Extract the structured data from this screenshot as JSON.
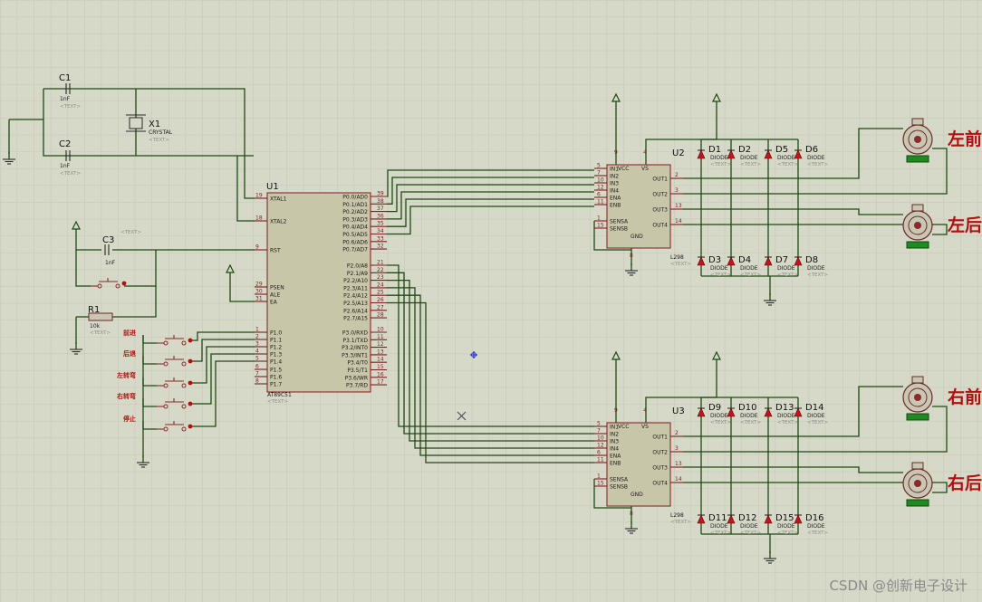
{
  "watermark": "CSDN @创新电子设计",
  "components": {
    "c1": {
      "ref": "C1",
      "value": "1nF",
      "text": "<TEXT>"
    },
    "c2": {
      "ref": "C2",
      "value": "1nF",
      "text": "<TEXT>"
    },
    "c3": {
      "ref": "C3",
      "value": "1nF",
      "text": "<TEXT>"
    },
    "x1": {
      "ref": "X1",
      "value": "CRYSTAL",
      "text": "<TEXT>"
    },
    "r1": {
      "ref": "R1",
      "value": "10k",
      "text": "<TEXT>"
    },
    "u1": {
      "ref": "U1",
      "part": "AT89C51",
      "text": "<TEXT>"
    },
    "u2": {
      "ref": "U2",
      "part": "L298",
      "text": "<TEXT>"
    },
    "u3": {
      "ref": "U3",
      "part": "L298",
      "text": "<TEXT>"
    }
  },
  "u1_pins_left": [
    {
      "num": "19",
      "name": "XTAL1"
    },
    {
      "num": "18",
      "name": "XTAL2"
    },
    {
      "num": "9",
      "name": "RST"
    },
    {
      "num": "29",
      "name": "PSEN"
    },
    {
      "num": "30",
      "name": "ALE"
    },
    {
      "num": "31",
      "name": "EA"
    },
    {
      "num": "1",
      "name": "P1.0"
    },
    {
      "num": "2",
      "name": "P1.1"
    },
    {
      "num": "3",
      "name": "P1.2"
    },
    {
      "num": "4",
      "name": "P1.3"
    },
    {
      "num": "5",
      "name": "P1.4"
    },
    {
      "num": "6",
      "name": "P1.5"
    },
    {
      "num": "7",
      "name": "P1.6"
    },
    {
      "num": "8",
      "name": "P1.7"
    }
  ],
  "u1_pins_right": [
    {
      "num": "39",
      "name": "P0.0/AD0"
    },
    {
      "num": "38",
      "name": "P0.1/AD1"
    },
    {
      "num": "37",
      "name": "P0.2/AD2"
    },
    {
      "num": "36",
      "name": "P0.3/AD3"
    },
    {
      "num": "35",
      "name": "P0.4/AD4"
    },
    {
      "num": "34",
      "name": "P0.5/AD5"
    },
    {
      "num": "33",
      "name": "P0.6/AD6"
    },
    {
      "num": "32",
      "name": "P0.7/AD7"
    },
    {
      "num": "21",
      "name": "P2.0/A8"
    },
    {
      "num": "22",
      "name": "P2.1/A9"
    },
    {
      "num": "23",
      "name": "P2.2/A10"
    },
    {
      "num": "24",
      "name": "P2.3/A11"
    },
    {
      "num": "25",
      "name": "P2.4/A12"
    },
    {
      "num": "26",
      "name": "P2.5/A13"
    },
    {
      "num": "27",
      "name": "P2.6/A14"
    },
    {
      "num": "28",
      "name": "P2.7/A15"
    },
    {
      "num": "10",
      "name": "P3.0/RXD"
    },
    {
      "num": "11",
      "name": "P3.1/TXD"
    },
    {
      "num": "12",
      "name": "P3.2/INT0"
    },
    {
      "num": "13",
      "name": "P3.3/INT1"
    },
    {
      "num": "14",
      "name": "P3.4/T0"
    },
    {
      "num": "15",
      "name": "P3.5/T1"
    },
    {
      "num": "16",
      "name": "P3.6/WR"
    },
    {
      "num": "17",
      "name": "P3.7/RD"
    }
  ],
  "l298_pins_left": [
    {
      "num": "5",
      "name": "IN1"
    },
    {
      "num": "7",
      "name": "IN2"
    },
    {
      "num": "10",
      "name": "IN3"
    },
    {
      "num": "12",
      "name": "IN4"
    },
    {
      "num": "6",
      "name": "ENA"
    },
    {
      "num": "11",
      "name": "ENB"
    },
    {
      "num": "1",
      "name": "SENSA"
    },
    {
      "num": "15",
      "name": "SENSB"
    }
  ],
  "l298_pins_right": [
    {
      "num": "2",
      "name": "OUT1"
    },
    {
      "num": "3",
      "name": "OUT2"
    },
    {
      "num": "13",
      "name": "OUT3"
    },
    {
      "num": "14",
      "name": "OUT4"
    }
  ],
  "l298_top": {
    "vcc_num": "9",
    "vcc": "VCC",
    "vs_num": "4",
    "vs": "VS"
  },
  "l298_bottom": {
    "gnd_num": "8",
    "gnd": "GND"
  },
  "diodes_u2_top": [
    "D1",
    "D2",
    "D5",
    "D6"
  ],
  "diodes_u2_bottom": [
    "D3",
    "D4",
    "D7",
    "D8"
  ],
  "diodes_u3_top": [
    "D9",
    "D10",
    "D13",
    "D14"
  ],
  "diodes_u3_bottom": [
    "D11",
    "D12",
    "D15",
    "D16"
  ],
  "diode_type": "DIODE",
  "placeholder": "<TEXT>",
  "buttons": [
    "前进",
    "后退",
    "左转弯",
    "右转弯",
    "停止"
  ],
  "motors": [
    "左前",
    "左后",
    "右前",
    "右后"
  ]
}
